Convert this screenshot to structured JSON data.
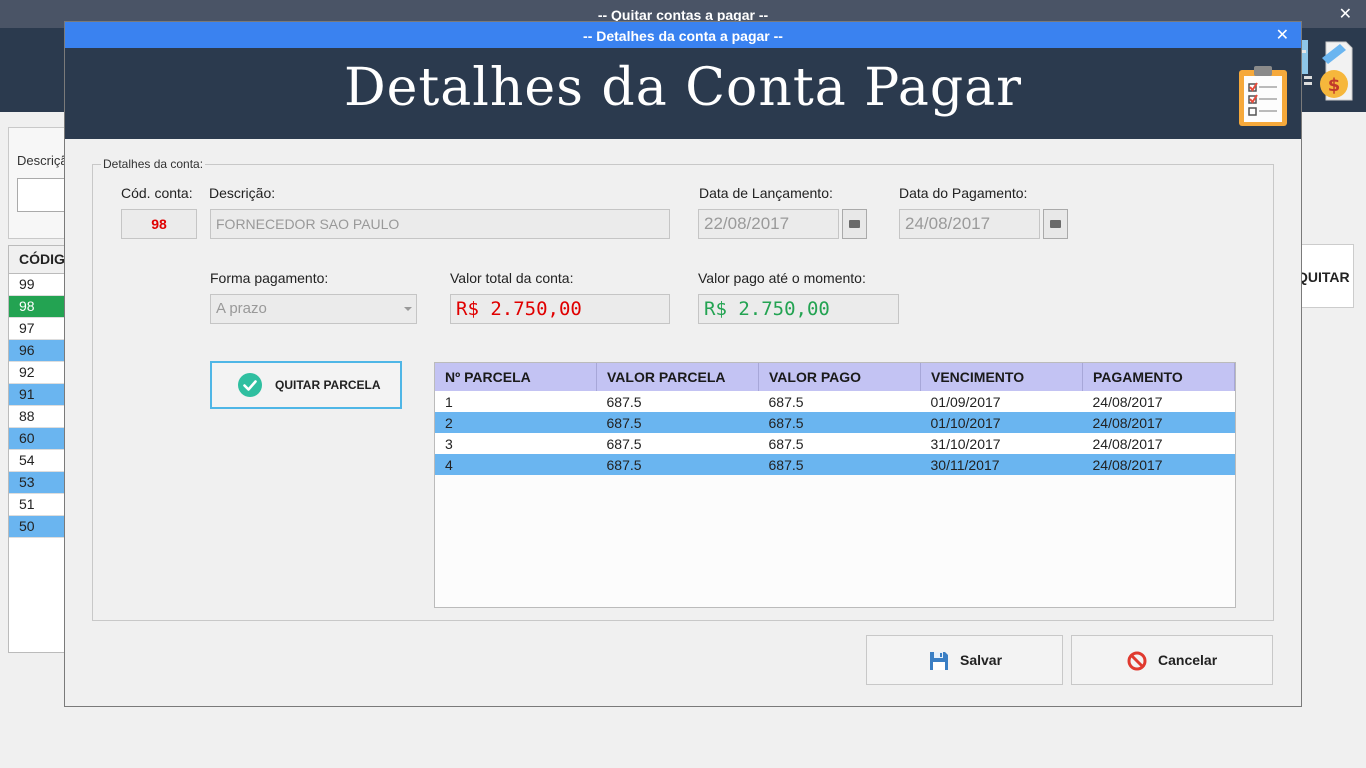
{
  "background_window": {
    "title": "-- Quitar contas a pagar --",
    "search_label": "Descrição:",
    "grid_header": "CÓDIGO",
    "codes": [
      "99",
      "98",
      "97",
      "96",
      "92",
      "91",
      "88",
      "60",
      "54",
      "53",
      "51",
      "50"
    ],
    "selected_code": "98",
    "quitar_button_label": "QUITAR"
  },
  "dialog": {
    "window_title": "-- Detalhes da conta a pagar --",
    "header_title": "Detalhes da Conta Pagar",
    "groupbox_label": "Detalhes da conta:",
    "fields": {
      "cod_conta": {
        "label": "Cód. conta:",
        "value": "98"
      },
      "descricao": {
        "label": "Descrição:",
        "value": "FORNECEDOR SAO PAULO"
      },
      "data_lancamento": {
        "label": "Data de Lançamento:",
        "value": "22/08/2017"
      },
      "data_pagamento": {
        "label": "Data do Pagamento:",
        "value": "24/08/2017"
      },
      "forma_pagamento": {
        "label": "Forma pagamento:",
        "value": "A prazo"
      },
      "valor_total": {
        "label": "Valor total da conta:",
        "value": "R$ 2.750,00"
      },
      "valor_pago": {
        "label": "Valor pago até o momento:",
        "value": "R$ 2.750,00"
      }
    },
    "quitar_parcela_label": "QUITAR PARCELA",
    "table": {
      "columns": [
        "Nº PARCELA",
        "VALOR PARCELA",
        "VALOR PAGO",
        "VENCIMENTO",
        "PAGAMENTO"
      ],
      "rows": [
        [
          "1",
          "687.5",
          "687.5",
          "01/09/2017",
          "24/08/2017"
        ],
        [
          "2",
          "687.5",
          "687.5",
          "01/10/2017",
          "24/08/2017"
        ],
        [
          "3",
          "687.5",
          "687.5",
          "31/10/2017",
          "24/08/2017"
        ],
        [
          "4",
          "687.5",
          "687.5",
          "30/11/2017",
          "24/08/2017"
        ]
      ]
    },
    "buttons": {
      "save": "Salvar",
      "cancel": "Cancelar"
    }
  },
  "colors": {
    "title_bar": "#3a82f0",
    "header_bg": "#2b3a4e",
    "row_alt": "#6ab5f0",
    "row_selected": "#23a352",
    "table_header": "#c3c3f3",
    "money_total": "#e00000",
    "money_paid": "#23a352"
  },
  "icons": [
    "close-icon",
    "clipboard-checklist-icon",
    "money-document-icon",
    "calendar-icon",
    "check-circle-icon",
    "floppy-disk-icon",
    "cancel-icon",
    "dropdown-arrow-icon"
  ]
}
